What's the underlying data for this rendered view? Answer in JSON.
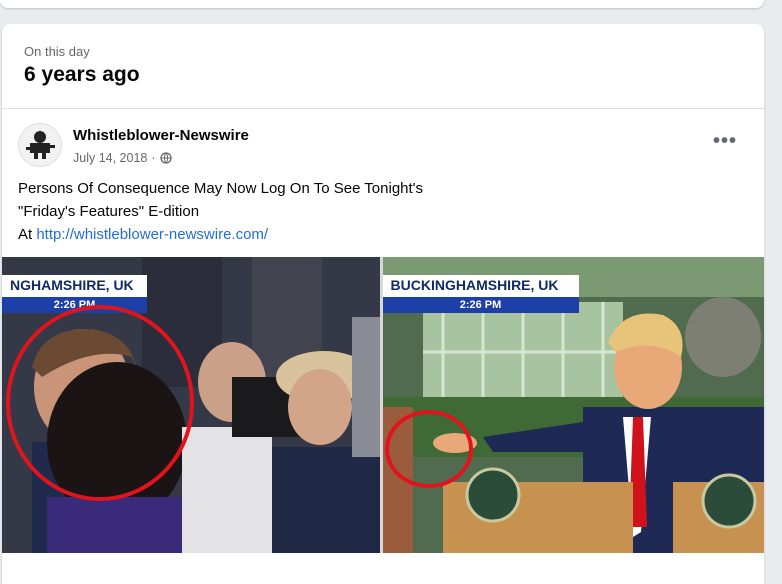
{
  "header": {
    "kicker": "On this day",
    "title": "6 years ago"
  },
  "post": {
    "author": "Whistleblower-Newswire",
    "date": "July 14, 2018",
    "separator": "·",
    "audience_icon": "globe-icon",
    "more_label": "•••",
    "text_line1": "Persons Of Consequence May Now Log On To See Tonight's",
    "text_line2": "\"Friday's Features\" E-dition",
    "text_line3_prefix": "At ",
    "link": "http://whistleblower-newswire.com/"
  },
  "image": {
    "left_banner": "NGHAMSHIRE, UK",
    "left_time": "2:26 PM",
    "right_banner": "BUCKINGHAMSHIRE, UK",
    "right_time": "2:26 PM",
    "highlight_color": "#e0141c"
  }
}
